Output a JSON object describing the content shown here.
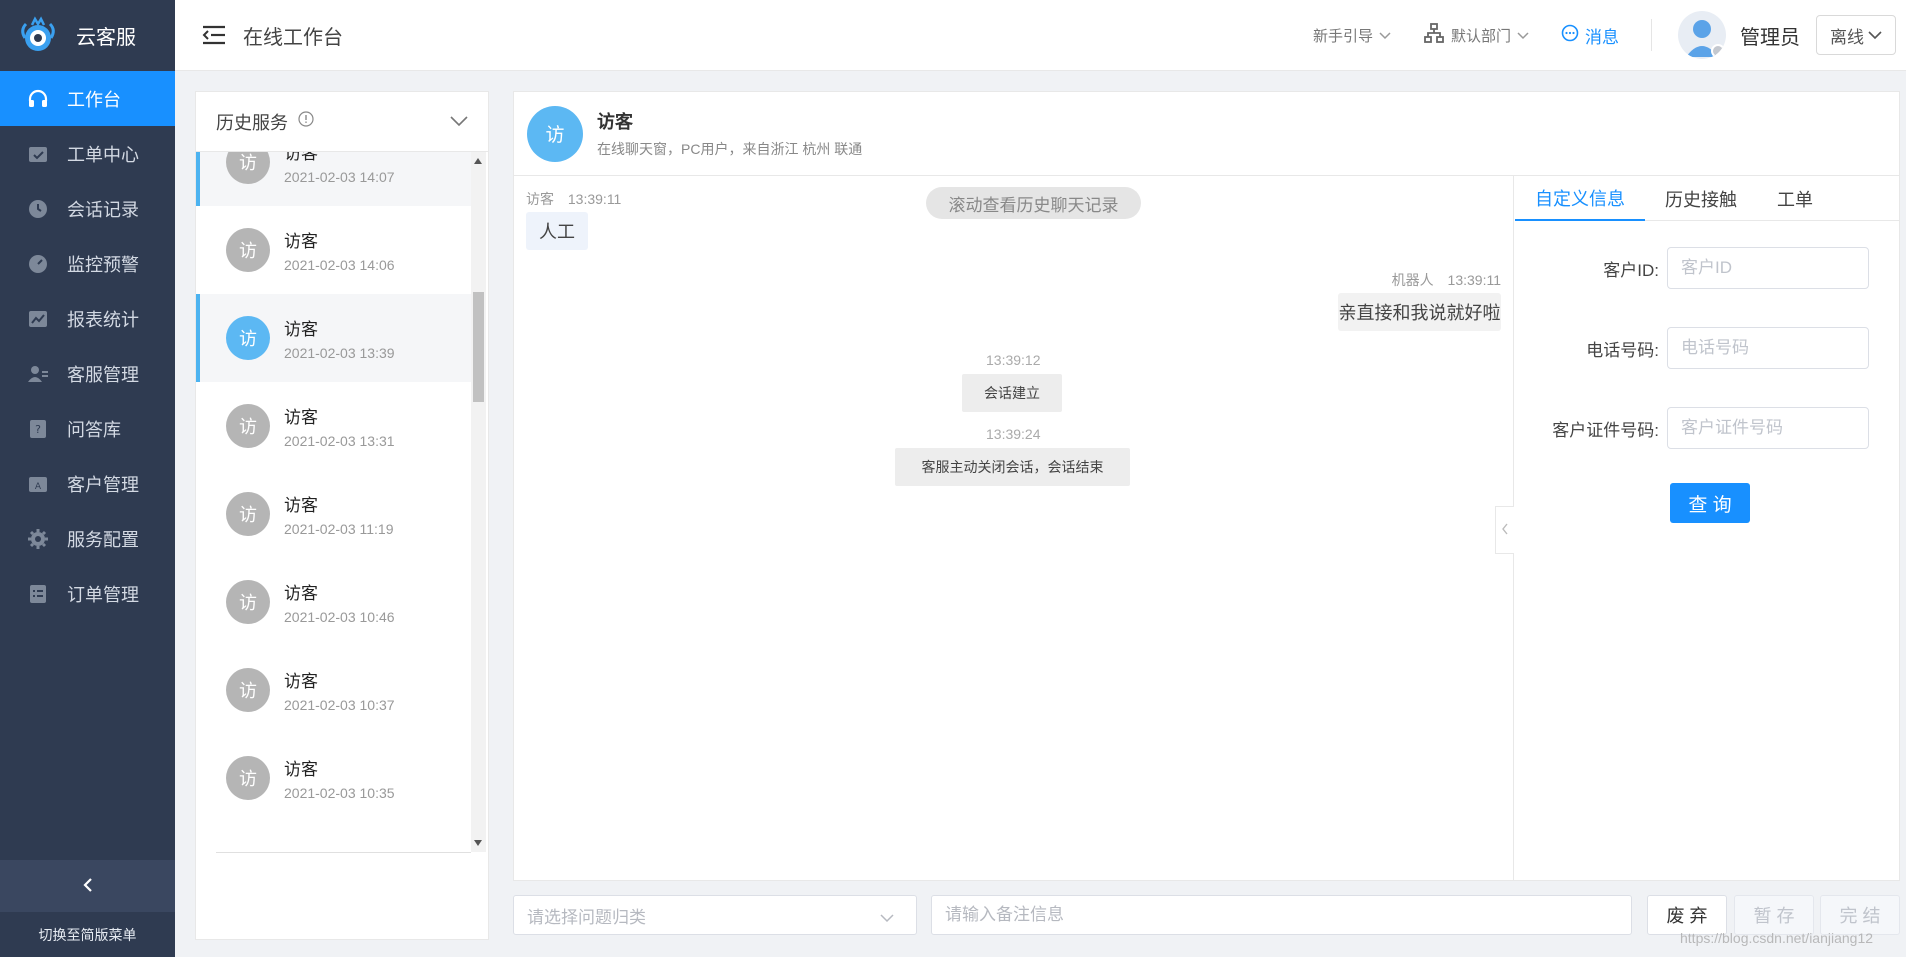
{
  "app": {
    "name": "云客服"
  },
  "sidebar": {
    "items": [
      {
        "label": "工作台",
        "icon": "headset-icon",
        "active": true
      },
      {
        "label": "工单中心",
        "icon": "ticket-icon"
      },
      {
        "label": "会话记录",
        "icon": "clock-icon"
      },
      {
        "label": "监控预警",
        "icon": "gauge-icon"
      },
      {
        "label": "报表统计",
        "icon": "chart-icon"
      },
      {
        "label": "客服管理",
        "icon": "agent-icon"
      },
      {
        "label": "问答库",
        "icon": "faq-icon"
      },
      {
        "label": "客户管理",
        "icon": "customer-icon"
      },
      {
        "label": "服务配置",
        "icon": "gear-icon"
      },
      {
        "label": "订单管理",
        "icon": "order-icon"
      }
    ],
    "switch_label": "切换至简版菜单"
  },
  "header": {
    "title": "在线工作台",
    "guide": "新手引导",
    "department": "默认部门",
    "messages": "消息",
    "admin": "管理员",
    "status": "离线"
  },
  "history": {
    "title": "历史服务",
    "items": [
      {
        "avatar": "访",
        "name": "访客",
        "time": "2021-02-03 14:07",
        "highlight": true,
        "blue": false
      },
      {
        "avatar": "访",
        "name": "访客",
        "time": "2021-02-03 14:06",
        "highlight": false,
        "blue": false
      },
      {
        "avatar": "访",
        "name": "访客",
        "time": "2021-02-03 13:39",
        "highlight": true,
        "blue": true
      },
      {
        "avatar": "访",
        "name": "访客",
        "time": "2021-02-03 13:31",
        "highlight": false,
        "blue": false
      },
      {
        "avatar": "访",
        "name": "访客",
        "time": "2021-02-03 11:19",
        "highlight": false,
        "blue": false
      },
      {
        "avatar": "访",
        "name": "访客",
        "time": "2021-02-03 10:46",
        "highlight": false,
        "blue": false
      },
      {
        "avatar": "访",
        "name": "访客",
        "time": "2021-02-03 10:37",
        "highlight": false,
        "blue": false
      },
      {
        "avatar": "访",
        "name": "访客",
        "time": "2021-02-03 10:35",
        "highlight": false,
        "blue": false
      }
    ]
  },
  "chat": {
    "avatar": "访",
    "name": "访客",
    "subtitle": "在线聊天窗，PC用户，来自浙江 杭州 联通",
    "history_pill": "滚动查看历史聊天记录",
    "visitor_sender": "访客",
    "visitor_time": "13:39:11",
    "visitor_msg": "人工",
    "robot_sender": "机器人",
    "robot_time": "13:39:11",
    "robot_msg": "亲直接和我说就好啦",
    "sys1_time": "13:39:12",
    "sys1_msg": "会话建立",
    "sys2_time": "13:39:24",
    "sys2_msg": "客服主动关闭会话，会话结束"
  },
  "info": {
    "tabs": [
      "自定义信息",
      "历史接触",
      "工单"
    ],
    "fields": [
      {
        "label": "客户ID:",
        "placeholder": "客户ID"
      },
      {
        "label": "电话号码:",
        "placeholder": "电话号码"
      },
      {
        "label": "客户证件号码:",
        "placeholder": "客户证件号码"
      }
    ],
    "query_label": "查 询"
  },
  "bottom": {
    "category_placeholder": "请选择问题归类",
    "note_placeholder": "请输入备注信息",
    "discard": "废 弃",
    "save": "暂 存",
    "finish": "完 结"
  },
  "watermark": "https://blog.csdn.net/ianjiang12",
  "colors": {
    "accent": "#1890ff",
    "sidebar": "#2f3b51",
    "avatar_blue": "#5cb8f3",
    "avatar_gray": "#b5b5b5"
  }
}
